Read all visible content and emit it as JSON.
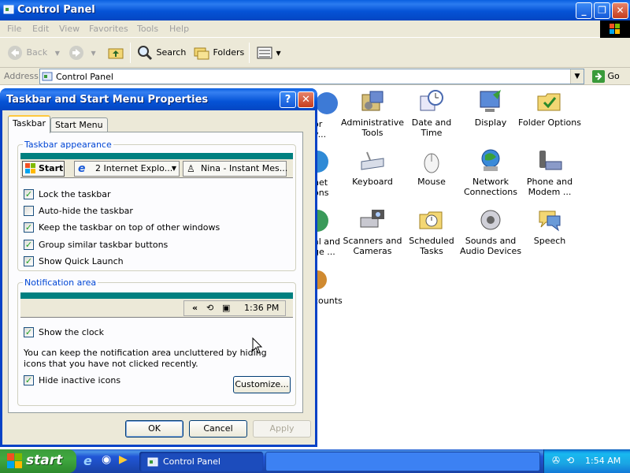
{
  "window": {
    "title": "Control Panel"
  },
  "menubar": {
    "items": [
      "File",
      "Edit",
      "View",
      "Favorites",
      "Tools",
      "Help"
    ]
  },
  "toolbar": {
    "back_label": "Back",
    "search_label": "Search",
    "folders_label": "Folders"
  },
  "address": {
    "label": "Address",
    "value": "Control Panel",
    "go_label": "Go"
  },
  "control_panel_items": {
    "partial_1": [
      "or",
      "v..."
    ],
    "partial_2": [
      "net",
      "ons"
    ],
    "partial_3": [
      "al and",
      "ge ..."
    ],
    "partial_4": [
      "counts"
    ],
    "administrative_tools": [
      "Administrative",
      "Tools"
    ],
    "date_and_time": [
      "Date and Time"
    ],
    "display": [
      "Display"
    ],
    "folder_options": [
      "Folder Options"
    ],
    "keyboard": [
      "Keyboard"
    ],
    "mouse": [
      "Mouse"
    ],
    "network_connections": [
      "Network",
      "Connections"
    ],
    "phone_and_modem": [
      "Phone and",
      "Modem ..."
    ],
    "scanners_and_cameras": [
      "Scanners and",
      "Cameras"
    ],
    "scheduled_tasks": [
      "Scheduled",
      "Tasks"
    ],
    "sounds_and_audio": [
      "Sounds and",
      "Audio Devices"
    ],
    "speech": [
      "Speech"
    ]
  },
  "dialog": {
    "title": "Taskbar and Start Menu Properties",
    "tabs": [
      "Taskbar",
      "Start Menu"
    ],
    "taskbar_appearance": {
      "title": "Taskbar appearance",
      "preview_start": "Start",
      "preview_button_1": "2 Internet Explo...",
      "preview_button_2": "Nina - Instant Mes...",
      "options": [
        {
          "label": "Lock the taskbar",
          "checked": true
        },
        {
          "label": "Auto-hide the taskbar",
          "checked": false
        },
        {
          "label": "Keep the taskbar on top of other windows",
          "checked": true
        },
        {
          "label": "Group similar taskbar buttons",
          "checked": true
        },
        {
          "label": "Show Quick Launch",
          "checked": true
        }
      ]
    },
    "notification_area": {
      "title": "Notification area",
      "preview_expand": "«",
      "preview_time": "1:36 PM",
      "show_clock": {
        "label": "Show the clock",
        "checked": true
      },
      "description": "You can keep the notification area uncluttered by hiding icons that you have not clicked recently.",
      "hide_inactive": {
        "label": "Hide inactive icons",
        "checked": true
      },
      "customize_label": "Customize..."
    },
    "buttons": {
      "ok": "OK",
      "cancel": "Cancel",
      "apply": "Apply"
    }
  },
  "taskbar": {
    "start_label": "start",
    "task_label": "Control Panel",
    "clock": "1:54 AM"
  },
  "colors": {
    "title_blue": "#0553d6",
    "taskbar_blue": "#2157d7",
    "start_green": "#3c9c3c",
    "dialog_face": "#ece9d8",
    "group_title": "#0046d5"
  }
}
